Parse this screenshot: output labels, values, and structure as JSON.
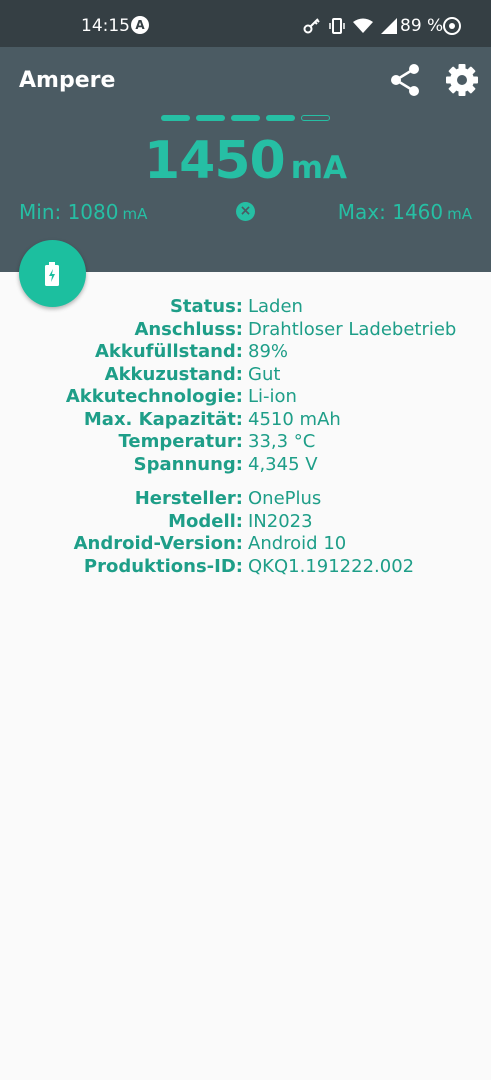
{
  "status_bar": {
    "time": "14:15",
    "battery_percent": "89 %",
    "icons": [
      "a-icon",
      "key-icon",
      "vibrate-icon",
      "wifi-icon",
      "signal-icon",
      "circle-icon"
    ]
  },
  "header": {
    "title": "Ampere",
    "current_value": "1450",
    "current_unit": "mA",
    "level_bars": {
      "filled": 4,
      "total": 5
    },
    "min_label": "Min: 1080",
    "max_label": "Max: 1460",
    "unit": "mA",
    "reset_icon": "close-circle-icon"
  },
  "colors": {
    "accent": "#26bfa4",
    "header_bg": "#4b5b63",
    "status_bg": "#353f44",
    "text": "#1e9e88"
  },
  "info_group1": [
    {
      "label": "Status:",
      "value": "Laden"
    },
    {
      "label": "Anschluss:",
      "value": "Drahtloser Ladebetrieb"
    },
    {
      "label": "Akkufüllstand:",
      "value": "89%"
    },
    {
      "label": "Akkuzustand:",
      "value": "Gut"
    },
    {
      "label": "Akkutechnologie:",
      "value": "Li-ion"
    },
    {
      "label": "Max. Kapazität:",
      "value": "4510 mAh"
    },
    {
      "label": "Temperatur:",
      "value": "33,3 °C"
    },
    {
      "label": "Spannung:",
      "value": "4,345 V"
    }
  ],
  "info_group2": [
    {
      "label": "Hersteller:",
      "value": "OnePlus"
    },
    {
      "label": "Modell:",
      "value": "IN2023"
    },
    {
      "label": "Android-Version:",
      "value": "Android 10"
    },
    {
      "label": "Produktions-ID:",
      "value": "QKQ1.191222.002"
    }
  ]
}
